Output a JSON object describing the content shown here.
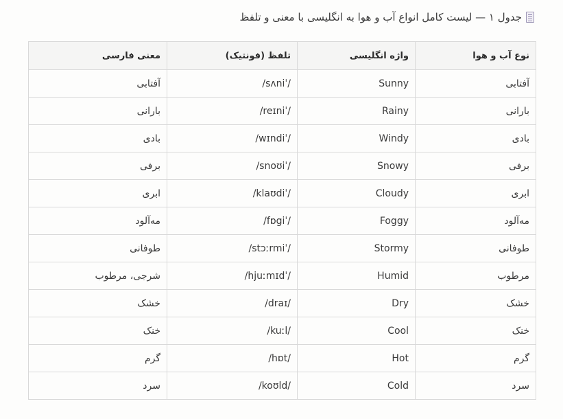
{
  "caption": {
    "icon": "document-icon",
    "text": "جدول ۱ — لیست کامل انواع آب و هوا به انگلیسی با معنی و تلفظ"
  },
  "table": {
    "headers": [
      "نوع آب و هوا",
      "واژه انگلیسی",
      "تلفظ (فونتیک)",
      "معنی فارسی"
    ],
    "rows": [
      [
        "آفتابی",
        "Sunny",
        "/sʌniˈ/",
        "آفتابی"
      ],
      [
        "بارانی",
        "Rainy",
        "/reɪniˈ/",
        "بارانی"
      ],
      [
        "بادی",
        "Windy",
        "/wɪndiˈ/",
        "بادی"
      ],
      [
        "برفی",
        "Snowy",
        "/snoʊiˈ/",
        "برفی"
      ],
      [
        "ابری",
        "Cloudy",
        "/klaʊdiˈ/",
        "ابری"
      ],
      [
        "مه‌آلود",
        "Foggy",
        "/fɒgiˈ/",
        "مه‌آلود"
      ],
      [
        "طوفانی",
        "Stormy",
        "/stɔːrmiˈ/",
        "طوفانی"
      ],
      [
        "مرطوب",
        "Humid",
        "/hjuːmɪdˈ/",
        "شرجی، مرطوب"
      ],
      [
        "خشک",
        "Dry",
        "/draɪ/",
        "خشک"
      ],
      [
        "خنک",
        "Cool",
        "/kuːl/",
        "خنک"
      ],
      [
        "گرم",
        "Hot",
        "/hɒt/",
        "گرم"
      ],
      [
        "سرد",
        "Cold",
        "/koʊld/",
        "سرد"
      ]
    ]
  }
}
